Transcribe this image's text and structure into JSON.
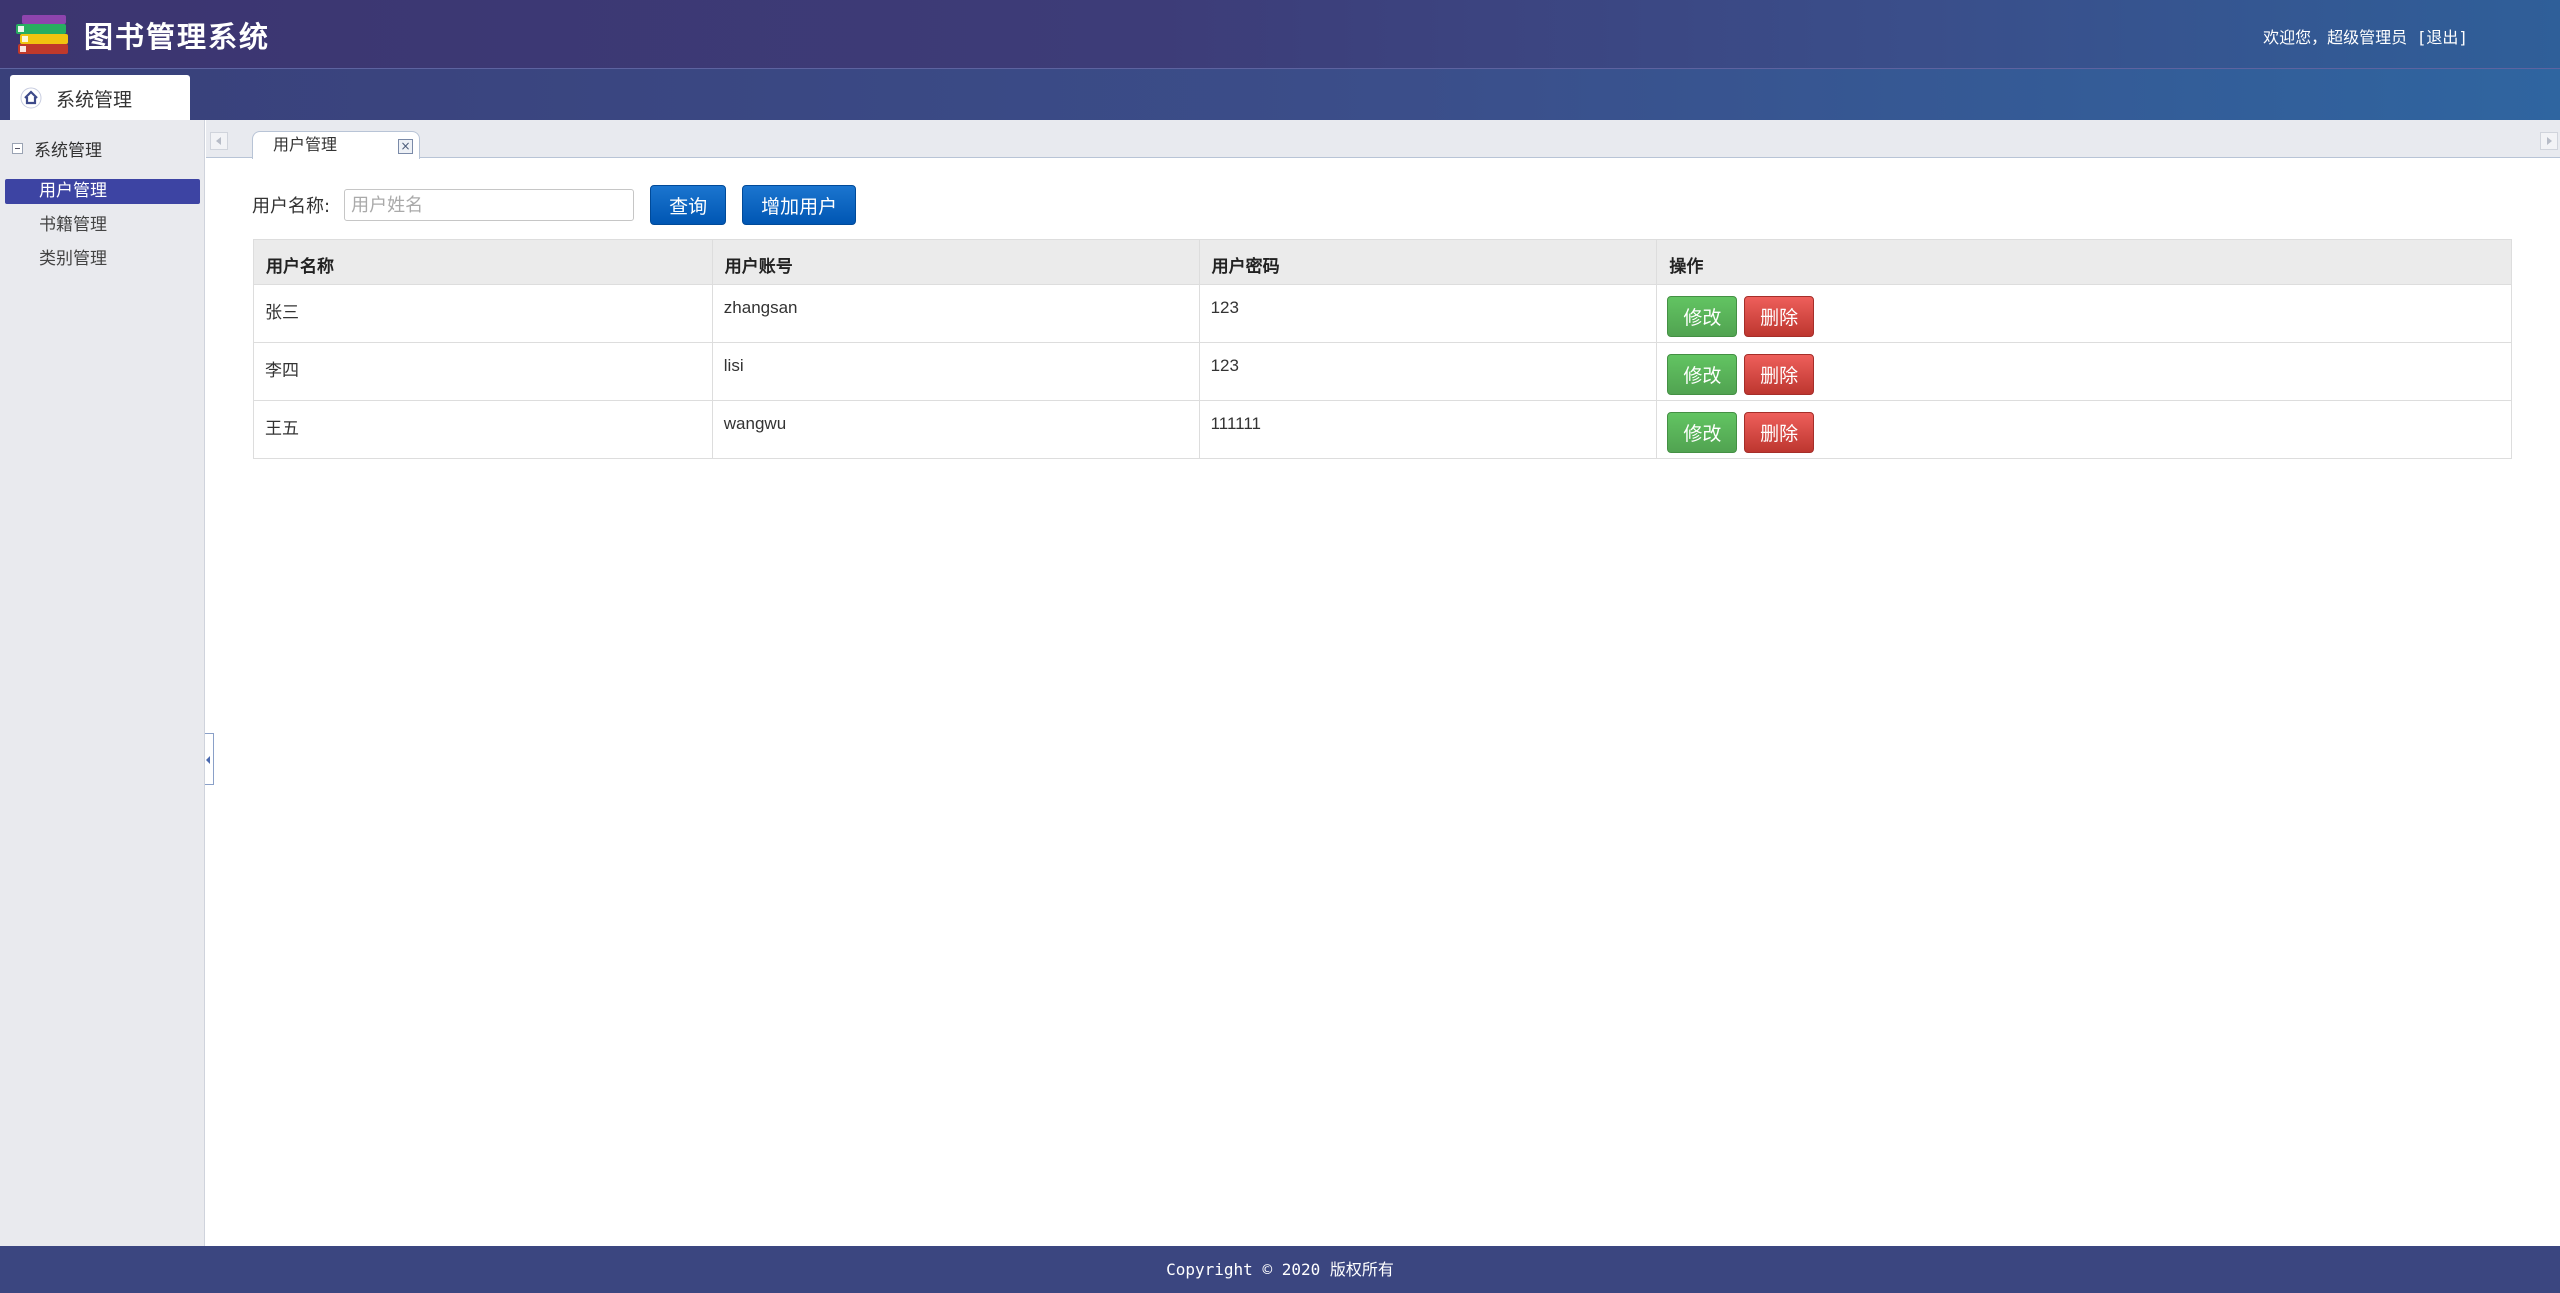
{
  "header": {
    "app_title": "图书管理系统",
    "welcome_text": "欢迎您，超级管理员",
    "logout_label": "[退出]"
  },
  "nav": {
    "active_tab": "系统管理"
  },
  "sidebar": {
    "group_label": "系统管理",
    "items": [
      {
        "label": "用户管理",
        "active": true
      },
      {
        "label": "书籍管理",
        "active": false
      },
      {
        "label": "类别管理",
        "active": false
      }
    ]
  },
  "tabs": {
    "open_tab": "用户管理",
    "close_symbol": "×"
  },
  "search": {
    "label": "用户名称:",
    "placeholder": "用户姓名",
    "query_button": "查询",
    "add_button": "增加用户"
  },
  "table": {
    "headers": [
      "用户名称",
      "用户账号",
      "用户密码",
      "操作"
    ],
    "rows": [
      {
        "name": "张三",
        "account": "zhangsan",
        "password": "123"
      },
      {
        "name": "李四",
        "account": "lisi",
        "password": "123"
      },
      {
        "name": "王五",
        "account": "wangwu",
        "password": "111111"
      }
    ],
    "edit_label": "修改",
    "delete_label": "删除"
  },
  "footer": {
    "copyright": "Copyright © 2020 版权所有"
  },
  "colors": {
    "header_bg": "#3c3570",
    "sidebar_active": "#3d44a3",
    "primary_button": "#0056b3",
    "edit_button": "#51a351",
    "delete_button": "#bd362f",
    "footer_bg": "#3b4680"
  },
  "icons": {
    "logo": "books-stack-icon",
    "nav_home": "home-icon",
    "tab_close": "close-icon"
  }
}
